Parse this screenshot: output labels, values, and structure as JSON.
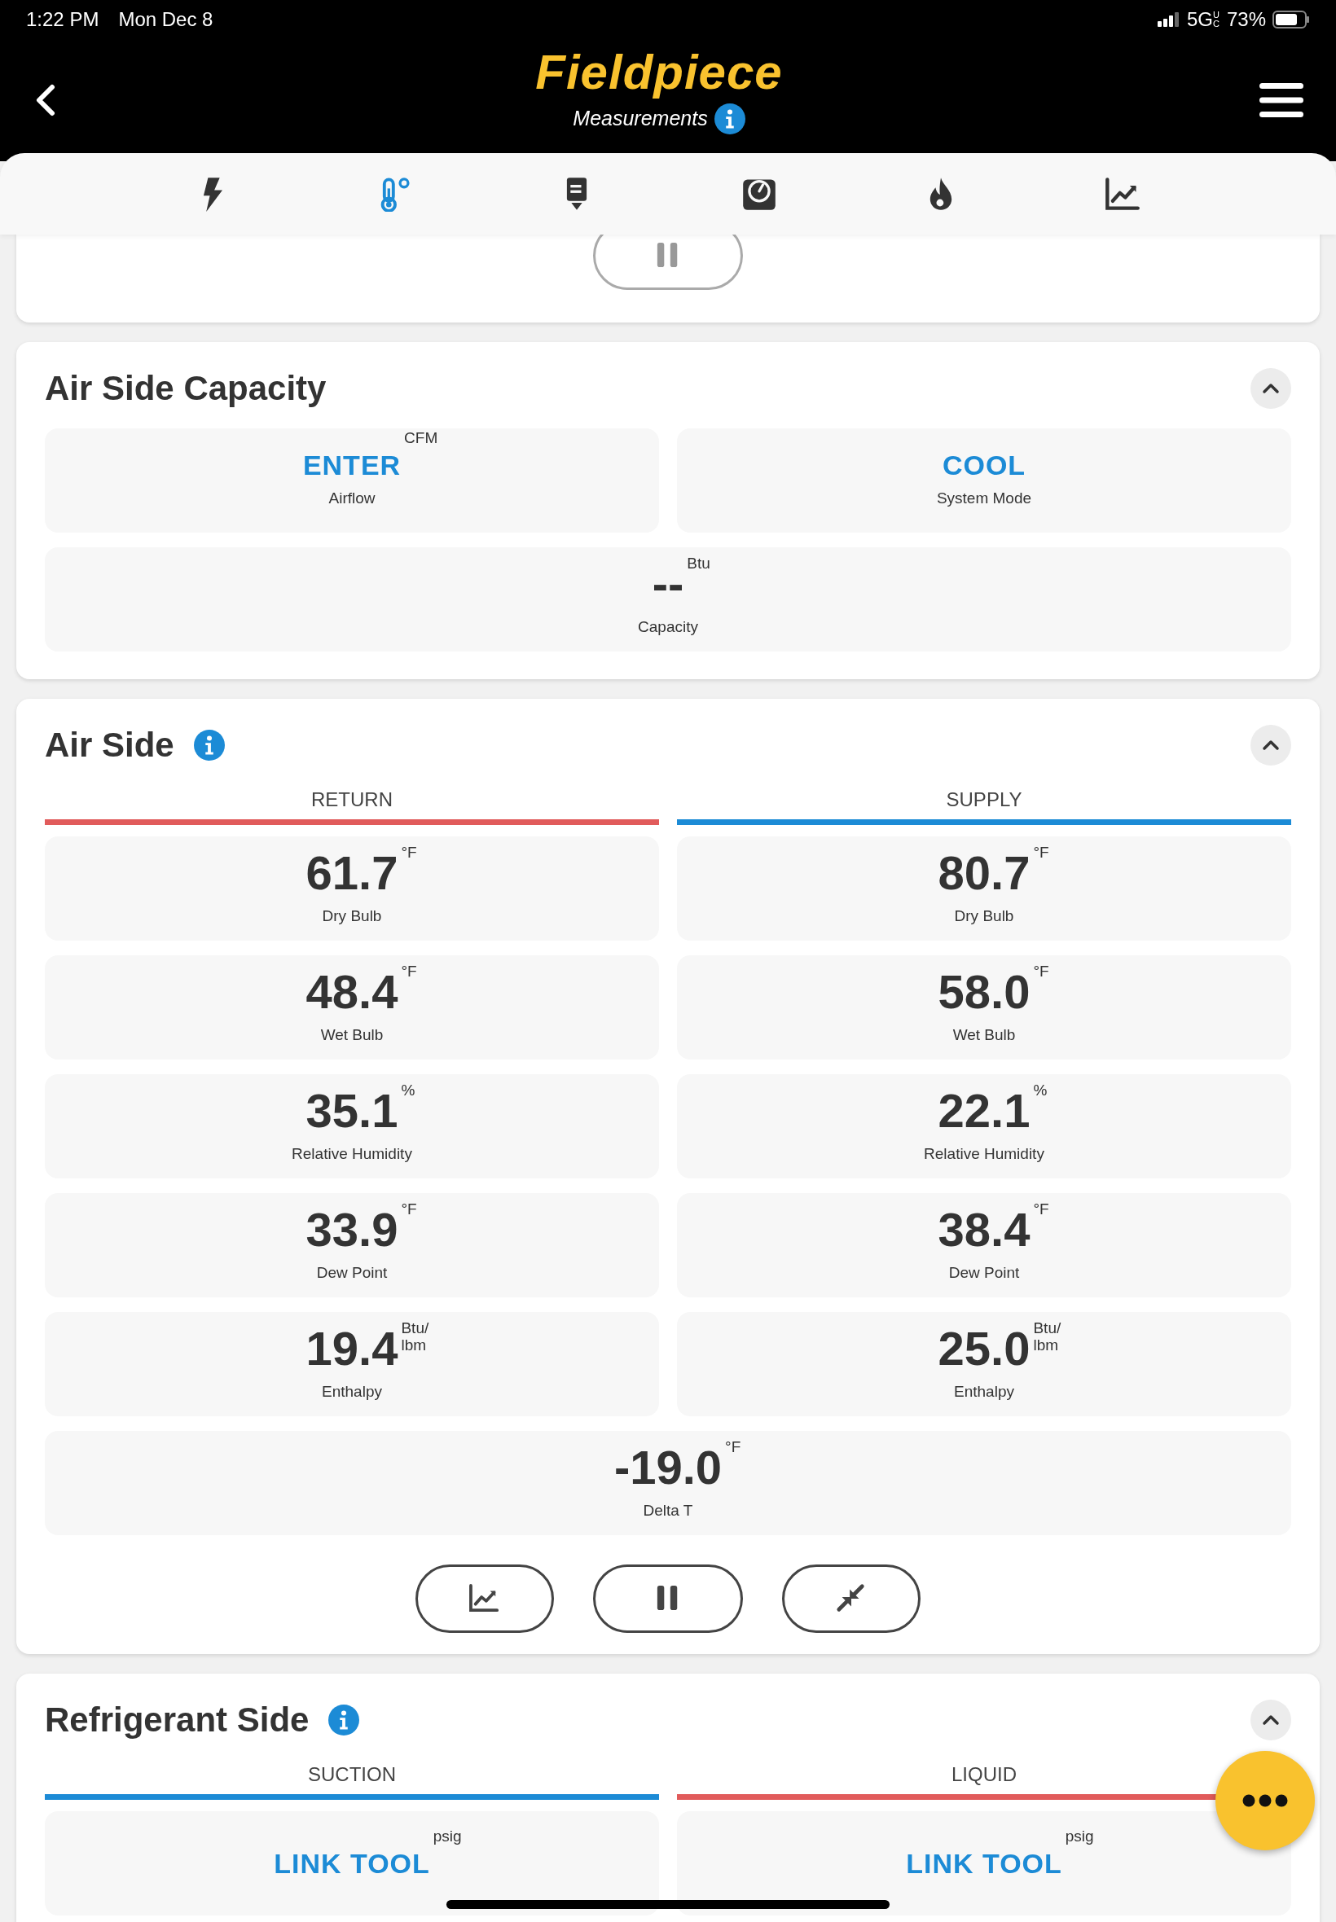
{
  "status_bar": {
    "time": "1:22 PM",
    "date": "Mon Dec 8",
    "network": "5G",
    "network_sub": "UC",
    "battery": "73%"
  },
  "header": {
    "title": "Fieldpiece",
    "subtitle": "Measurements"
  },
  "tabs": [
    {
      "kind": "bolt",
      "selected": false
    },
    {
      "kind": "thermometer",
      "selected": true
    },
    {
      "kind": "clamp",
      "selected": false
    },
    {
      "kind": "gauge",
      "selected": false
    },
    {
      "kind": "flame",
      "selected": false
    },
    {
      "kind": "chart",
      "selected": false
    }
  ],
  "sections": [
    {
      "kind": "partial",
      "buttons": [
        {
          "kind": "pause",
          "disabled": true
        }
      ]
    },
    {
      "kind": "tiles",
      "title": "Air Side Capacity",
      "expanded": true,
      "tiles": [
        {
          "value": "ENTER",
          "unit": "CFM",
          "label": "Airflow",
          "kind": "action",
          "wide": false
        },
        {
          "value": "COOL",
          "label": "System Mode",
          "kind": "action",
          "wide": false
        },
        {
          "value": "--",
          "unit": "Btu",
          "label": "Capacity",
          "kind": "reading",
          "wide": true
        }
      ]
    },
    {
      "kind": "columns",
      "title": "Air Side",
      "info": true,
      "expanded": true,
      "columns": [
        {
          "label": "RETURN",
          "color": "#e15b5b"
        },
        {
          "label": "SUPPLY",
          "color": "#1c8bd6"
        }
      ],
      "tiles": [
        {
          "value": "61.7",
          "unit": "°F",
          "label": "Dry Bulb",
          "kind": "reading",
          "wide": false
        },
        {
          "value": "80.7",
          "unit": "°F",
          "label": "Dry Bulb",
          "kind": "reading",
          "wide": false
        },
        {
          "value": "48.4",
          "unit": "°F",
          "label": "Wet Bulb",
          "kind": "reading",
          "wide": false
        },
        {
          "value": "58.0",
          "unit": "°F",
          "label": "Wet Bulb",
          "kind": "reading",
          "wide": false
        },
        {
          "value": "35.1",
          "unit": "%",
          "label": "Relative Humidity",
          "kind": "reading",
          "wide": false
        },
        {
          "value": "22.1",
          "unit": "%",
          "label": "Relative Humidity",
          "kind": "reading",
          "wide": false
        },
        {
          "value": "33.9",
          "unit": "°F",
          "label": "Dew Point",
          "kind": "reading",
          "wide": false
        },
        {
          "value": "38.4",
          "unit": "°F",
          "label": "Dew Point",
          "kind": "reading",
          "wide": false
        },
        {
          "value": "19.4",
          "unit": "Btu/ lbm",
          "label": "Enthalpy",
          "kind": "reading",
          "wide": false
        },
        {
          "value": "25.0",
          "unit": "Btu/ lbm",
          "label": "Enthalpy",
          "kind": "reading",
          "wide": false
        },
        {
          "value": "-19.0",
          "unit": "°F",
          "label": "Delta T",
          "kind": "reading",
          "wide": true
        }
      ],
      "buttons": [
        {
          "kind": "chart",
          "disabled": false
        },
        {
          "kind": "pause",
          "disabled": false
        },
        {
          "kind": "collapse",
          "disabled": false
        }
      ]
    },
    {
      "kind": "columns",
      "title": "Refrigerant Side",
      "info": true,
      "expanded": true,
      "columns": [
        {
          "label": "SUCTION",
          "color": "#1c8bd6"
        },
        {
          "label": "LIQUID",
          "color": "#e15b5b"
        }
      ],
      "tiles": [
        {
          "value": "LINK TOOL",
          "unit": "psig",
          "kind": "action",
          "wide": false
        },
        {
          "value": "LINK TOOL",
          "unit": "psig",
          "kind": "action",
          "wide": false
        }
      ]
    }
  ]
}
